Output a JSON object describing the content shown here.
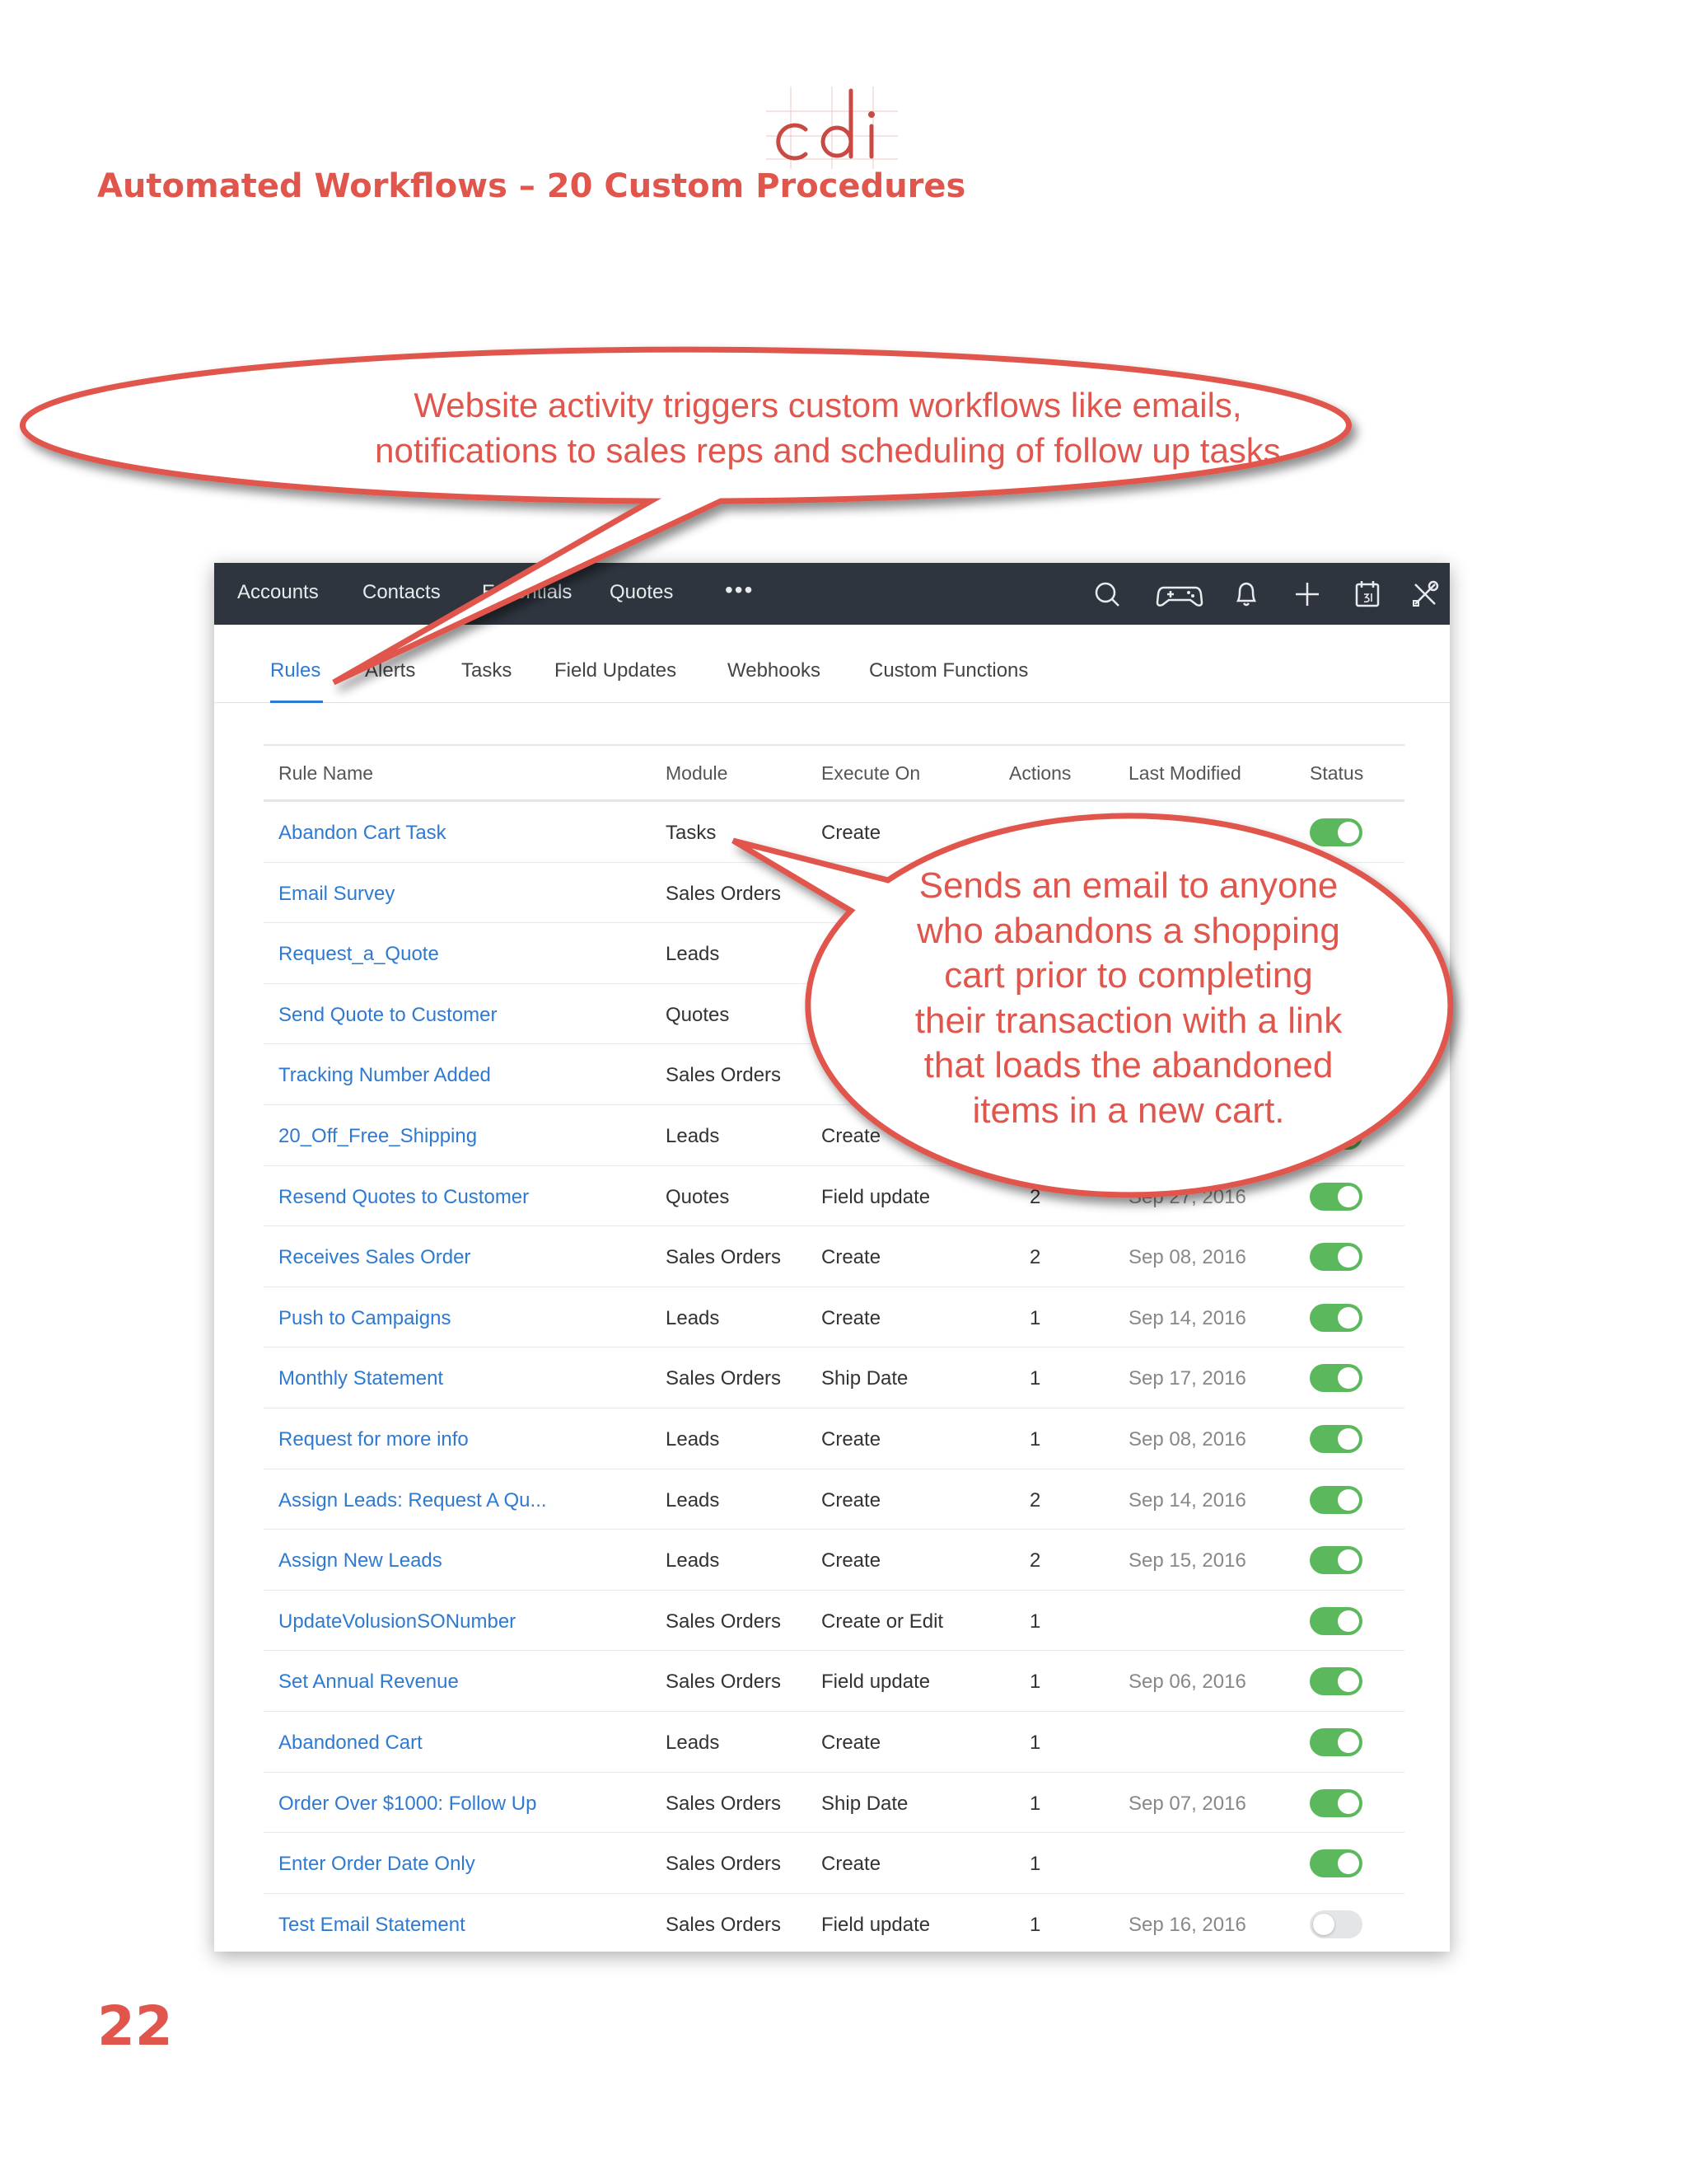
{
  "document": {
    "title": "Automated Workflows – 20 Custom Procedures",
    "page_number": "22"
  },
  "callouts": {
    "top_lines": [
      "Website activity triggers custom workflows like emails,",
      "notifications to sales reps and scheduling of follow up tasks"
    ],
    "right_lines": [
      "Sends an email to anyone",
      "who abandons a shopping",
      "cart prior to completing",
      "their transaction with a link",
      "that loads the abandoned",
      "items in a new cart."
    ]
  },
  "colors": {
    "accent_red": "#e0564d",
    "link_blue": "#2f7ad1",
    "toggle_on": "#5cb85c",
    "topbar": "#2f353f"
  },
  "topnav": {
    "items": [
      "Accounts",
      "Contacts",
      "Essentials",
      "Quotes"
    ],
    "more": "•••",
    "icons": [
      "search-icon",
      "gamepad-icon",
      "bell-icon",
      "plus-icon",
      "calendar-icon",
      "tools-icon"
    ]
  },
  "tabs": [
    "Rules",
    "Alerts",
    "Tasks",
    "Field Updates",
    "Webhooks",
    "Custom Functions"
  ],
  "table": {
    "headers": [
      "Rule Name",
      "Module",
      "Execute On",
      "Actions",
      "Last Modified",
      "Status"
    ],
    "rows": [
      {
        "name": "Abandon Cart Task",
        "module": "Tasks",
        "execute": "Create",
        "actions": "",
        "modified": "",
        "status": "on"
      },
      {
        "name": "Email Survey",
        "module": "Sales Orders",
        "execute": "",
        "actions": "",
        "modified": "",
        "status": "on"
      },
      {
        "name": "Request_a_Quote",
        "module": "Leads",
        "execute": "",
        "actions": "",
        "modified": "",
        "status": "on"
      },
      {
        "name": "Send Quote to Customer",
        "module": "Quotes",
        "execute": "",
        "actions": "",
        "modified": "",
        "status": "on"
      },
      {
        "name": "Tracking Number Added",
        "module": "Sales Orders",
        "execute": "",
        "actions": "",
        "modified": "",
        "status": "on"
      },
      {
        "name": "20_Off_Free_Shipping",
        "module": "Leads",
        "execute": "Create",
        "actions": "",
        "modified": "",
        "status": "on"
      },
      {
        "name": "Resend Quotes to Customer",
        "module": "Quotes",
        "execute": "Field update",
        "actions": "2",
        "modified": "Sep 27, 2016",
        "status": "on"
      },
      {
        "name": "Receives Sales Order",
        "module": "Sales Orders",
        "execute": "Create",
        "actions": "2",
        "modified": "Sep 08, 2016",
        "status": "on"
      },
      {
        "name": "Push to Campaigns",
        "module": "Leads",
        "execute": "Create",
        "actions": "1",
        "modified": "Sep 14, 2016",
        "status": "on"
      },
      {
        "name": "Monthly Statement",
        "module": "Sales Orders",
        "execute": "Ship Date",
        "actions": "1",
        "modified": "Sep 17, 2016",
        "status": "on"
      },
      {
        "name": "Request for more info",
        "module": "Leads",
        "execute": "Create",
        "actions": "1",
        "modified": "Sep 08, 2016",
        "status": "on"
      },
      {
        "name": "Assign Leads: Request A Qu...",
        "module": "Leads",
        "execute": "Create",
        "actions": "2",
        "modified": "Sep 14, 2016",
        "status": "on"
      },
      {
        "name": "Assign New Leads",
        "module": "Leads",
        "execute": "Create",
        "actions": "2",
        "modified": "Sep 15, 2016",
        "status": "on"
      },
      {
        "name": "UpdateVolusionSONumber",
        "module": "Sales Orders",
        "execute": "Create or Edit",
        "actions": "1",
        "modified": "",
        "status": "on"
      },
      {
        "name": "Set Annual Revenue",
        "module": "Sales Orders",
        "execute": "Field update",
        "actions": "1",
        "modified": "Sep 06, 2016",
        "status": "on"
      },
      {
        "name": "Abandoned Cart",
        "module": "Leads",
        "execute": "Create",
        "actions": "1",
        "modified": "",
        "status": "on"
      },
      {
        "name": "Order Over $1000: Follow Up",
        "module": "Sales Orders",
        "execute": "Ship Date",
        "actions": "1",
        "modified": "Sep 07, 2016",
        "status": "on"
      },
      {
        "name": "Enter Order Date Only",
        "module": "Sales Orders",
        "execute": "Create",
        "actions": "1",
        "modified": "",
        "status": "on"
      },
      {
        "name": "Test Email Statement",
        "module": "Sales Orders",
        "execute": "Field update",
        "actions": "1",
        "modified": "Sep 16, 2016",
        "status": "off"
      }
    ]
  }
}
